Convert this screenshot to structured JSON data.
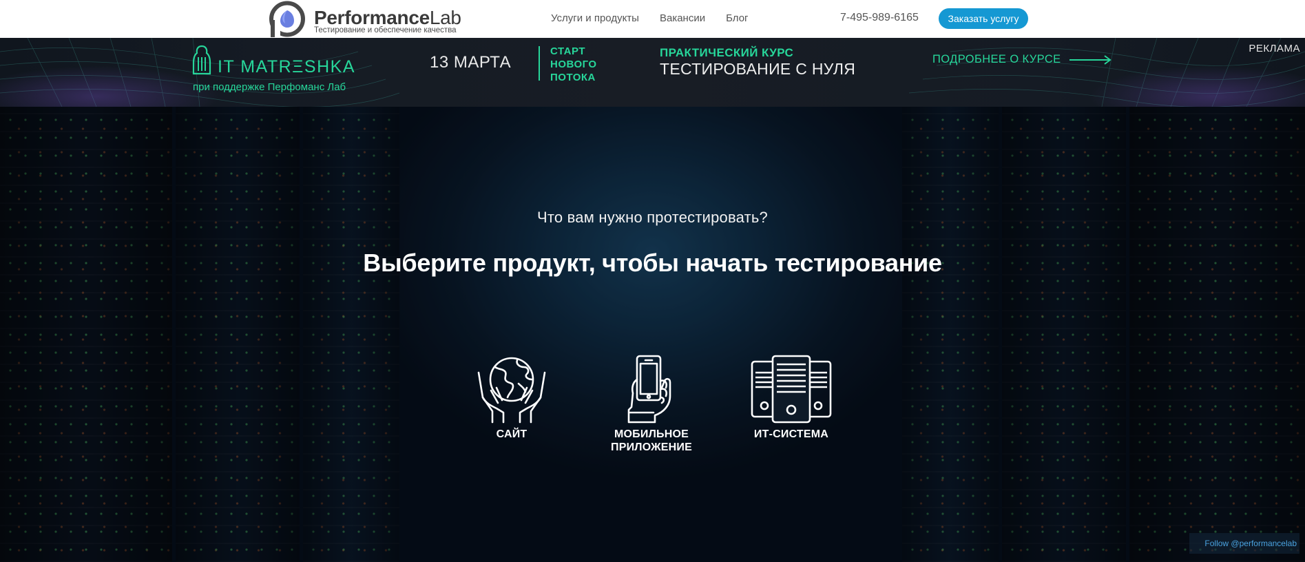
{
  "header": {
    "logo": {
      "brand_bold": "Performance",
      "brand_light": "Lab",
      "tagline": "Тестирование и обеспечение качества"
    },
    "nav": [
      {
        "label": "Услуги и продукты"
      },
      {
        "label": "Вакансии"
      },
      {
        "label": "Блог"
      }
    ],
    "phone": "7-495-989-6165",
    "cta_label": "Заказать услугу"
  },
  "banner": {
    "ad_label": "РЕКЛАМА",
    "brand": "IT MATRΞSHKA",
    "brand_sub": "при поддержке Перфоманс Лаб",
    "date": "13 МАРТА",
    "start": [
      "СТАРТ",
      "НОВОГО",
      "ПОТОКА"
    ],
    "course_kicker": "ПРАКТИЧЕСКИЙ КУРС",
    "course_title": "ТЕСТИРОВАНИЕ С НУЛЯ",
    "more_label": "ПОДРОБНЕЕ О КУРСЕ",
    "more_icon": "arrow-right-icon"
  },
  "hero": {
    "question": "Что вам нужно протестировать?",
    "heading": "Выберите продукт, чтобы начать тестирование",
    "products": [
      {
        "label_lines": [
          "САЙТ"
        ],
        "icon": "globe-in-hands-icon"
      },
      {
        "label_lines": [
          "МОБИЛЬНОЕ",
          "ПРИЛОЖЕНИЕ"
        ],
        "icon": "phone-in-hand-icon"
      },
      {
        "label_lines": [
          "ИТ-СИСТЕМА"
        ],
        "icon": "servers-icon"
      }
    ]
  },
  "footer_widget": {
    "follow_label": "Follow @performancelab"
  },
  "colors": {
    "accent_green": "#27d69a",
    "cta_blue": "#1598d3",
    "header_bg": "#ffffff",
    "banner_bg": "#151b24"
  }
}
